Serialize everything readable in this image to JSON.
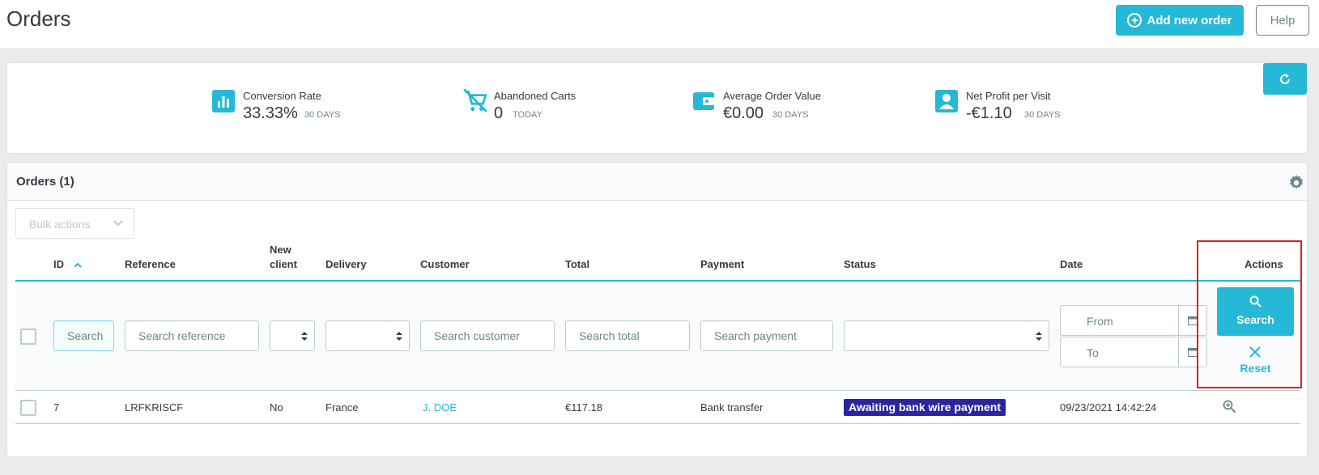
{
  "header": {
    "title": "Orders",
    "add_button": "Add new order",
    "help_button": "Help"
  },
  "kpis": [
    {
      "label": "Conversion Rate",
      "value": "33.33%",
      "period": "30 DAYS",
      "icon": "bar-chart-icon"
    },
    {
      "label": "Abandoned Carts",
      "value": "0",
      "period": "TODAY",
      "icon": "remove-cart-icon"
    },
    {
      "label": "Average Order Value",
      "value": "€0.00",
      "period": "30 DAYS",
      "icon": "wallet-icon"
    },
    {
      "label": "Net Profit per Visit",
      "value": "-€1.10",
      "period": "30 DAYS",
      "icon": "user-icon"
    }
  ],
  "orders_panel": {
    "title": "Orders (1)",
    "bulk_actions": "Bulk actions"
  },
  "table": {
    "columns": {
      "id": "ID",
      "reference": "Reference",
      "new_client_1": "New",
      "new_client_2": "client",
      "delivery": "Delivery",
      "customer": "Customer",
      "total": "Total",
      "payment": "Payment",
      "status": "Status",
      "date": "Date",
      "actions": "Actions"
    },
    "filters": {
      "id_placeholder": "Search",
      "reference_placeholder": "Search reference",
      "customer_placeholder": "Search customer",
      "total_placeholder": "Search total",
      "payment_placeholder": "Search payment",
      "date_from": "From",
      "date_to": "To",
      "search_button": "Search",
      "reset_button": "Reset"
    },
    "rows": [
      {
        "id": "7",
        "reference": "LRFKRISCF",
        "new_client": "No",
        "delivery": "France",
        "customer": "J. DOE",
        "total": "€117.18",
        "payment": "Bank transfer",
        "status": "Awaiting bank wire payment",
        "status_color": "#2b24a3",
        "date": "09/23/2021 14:42:24"
      }
    ]
  },
  "colors": {
    "accent": "#25b9d7",
    "highlight": "#e0201a"
  }
}
